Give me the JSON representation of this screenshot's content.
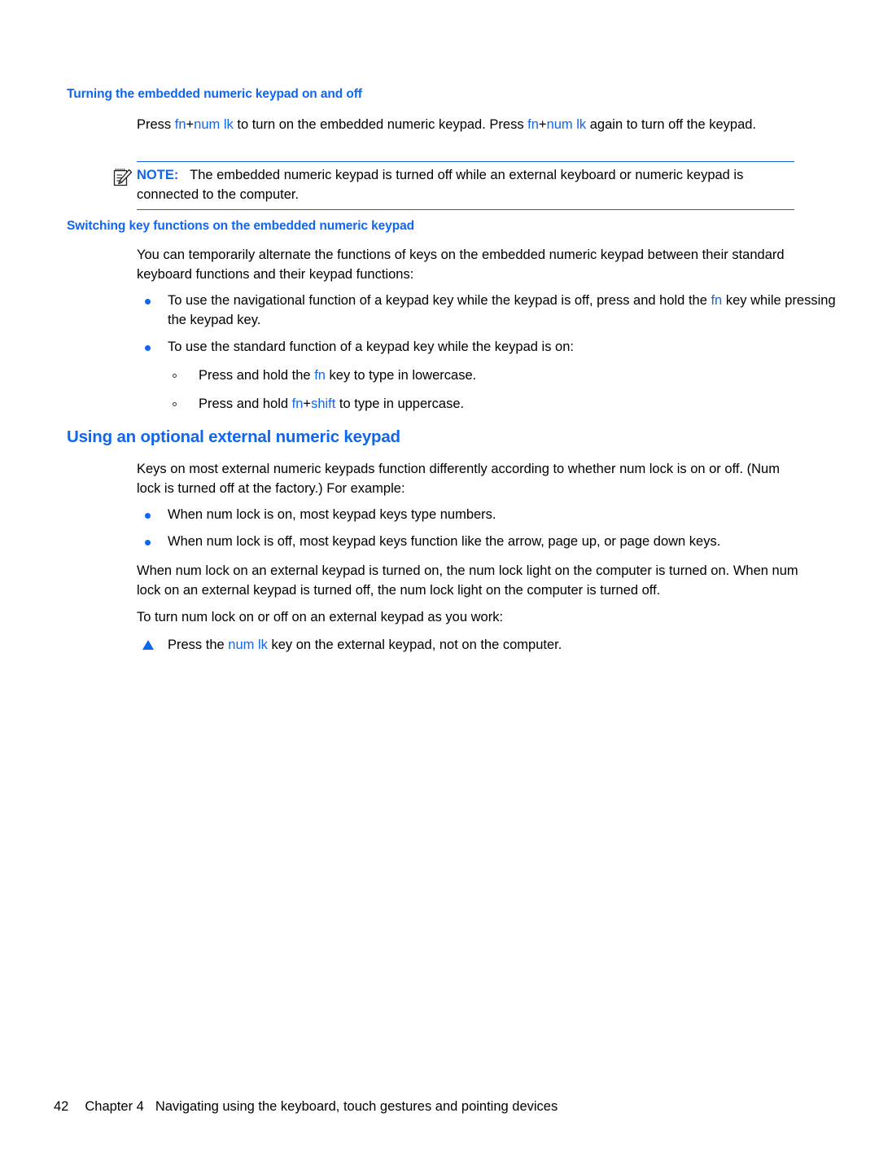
{
  "page": {
    "heading_embedded_onoff": "Turning the embedded numeric keypad on and off",
    "para_press_1": "Press ",
    "key_fn_1": "fn",
    "plus_1": "+",
    "key_numlk_1": "num lk",
    "para_press_2": " to turn on the embedded numeric keypad. Press ",
    "key_fn_2": "fn",
    "plus_2": "+",
    "key_numlk_2": "num lk",
    "para_press_3": " again to turn off the keypad.",
    "note": {
      "icon": "note-pencil-icon",
      "label": "NOTE:",
      "text": "The embedded numeric keypad is turned off while an external keyboard or numeric keypad is connected to the computer."
    },
    "heading_switching": "Switching key functions on the embedded numeric keypad",
    "para_alternate": "You can temporarily alternate the functions of keys on the embedded numeric keypad between their standard keyboard functions and their keypad functions:",
    "bullet_nav_a": "To use the navigational function of a keypad key while the keypad is off, press and hold the ",
    "bullet_nav_key": "fn",
    "bullet_nav_b": " key while pressing the keypad key.",
    "bullet_standard": "To use the standard function of a keypad key while the keypad is on:",
    "sub_lower_a": "Press and hold the ",
    "sub_lower_key": "fn",
    "sub_lower_b": " key to type in lowercase.",
    "sub_upper_a": "Press and hold ",
    "sub_upper_key1": "fn",
    "sub_upper_plus": "+",
    "sub_upper_key2": "shift",
    "sub_upper_b": " to type in uppercase.",
    "heading_external": "Using an optional external numeric keypad",
    "para_keys_external": "Keys on most external numeric keypads function differently according to whether num lock is on or off. (Num lock is turned off at the factory.) For example:",
    "bullet_numlock_on": "When num lock is on, most keypad keys type numbers.",
    "bullet_numlock_off": "When num lock is off, most keypad keys function like the arrow, page up, or page down keys.",
    "para_light_on": "When num lock on an external keypad is turned on, the num lock light on the computer is turned on.",
    "para_light_off": "When num lock on an external keypad is turned off, the num lock light on the computer is turned off.",
    "para_to_turn": "To turn num lock on or off on an external keypad as you work:",
    "step_press_a": "Press the ",
    "step_press_key": "num lk",
    "step_press_b": " key on the external keypad, not on the computer."
  },
  "footer": {
    "page_number": "42",
    "chapter": "Chapter 4",
    "chapter_title": "Navigating using the keyboard, touch gestures and pointing devices"
  },
  "colors": {
    "accent_blue": "#1166EE",
    "body_black": "#000000",
    "background": "#ffffff"
  }
}
